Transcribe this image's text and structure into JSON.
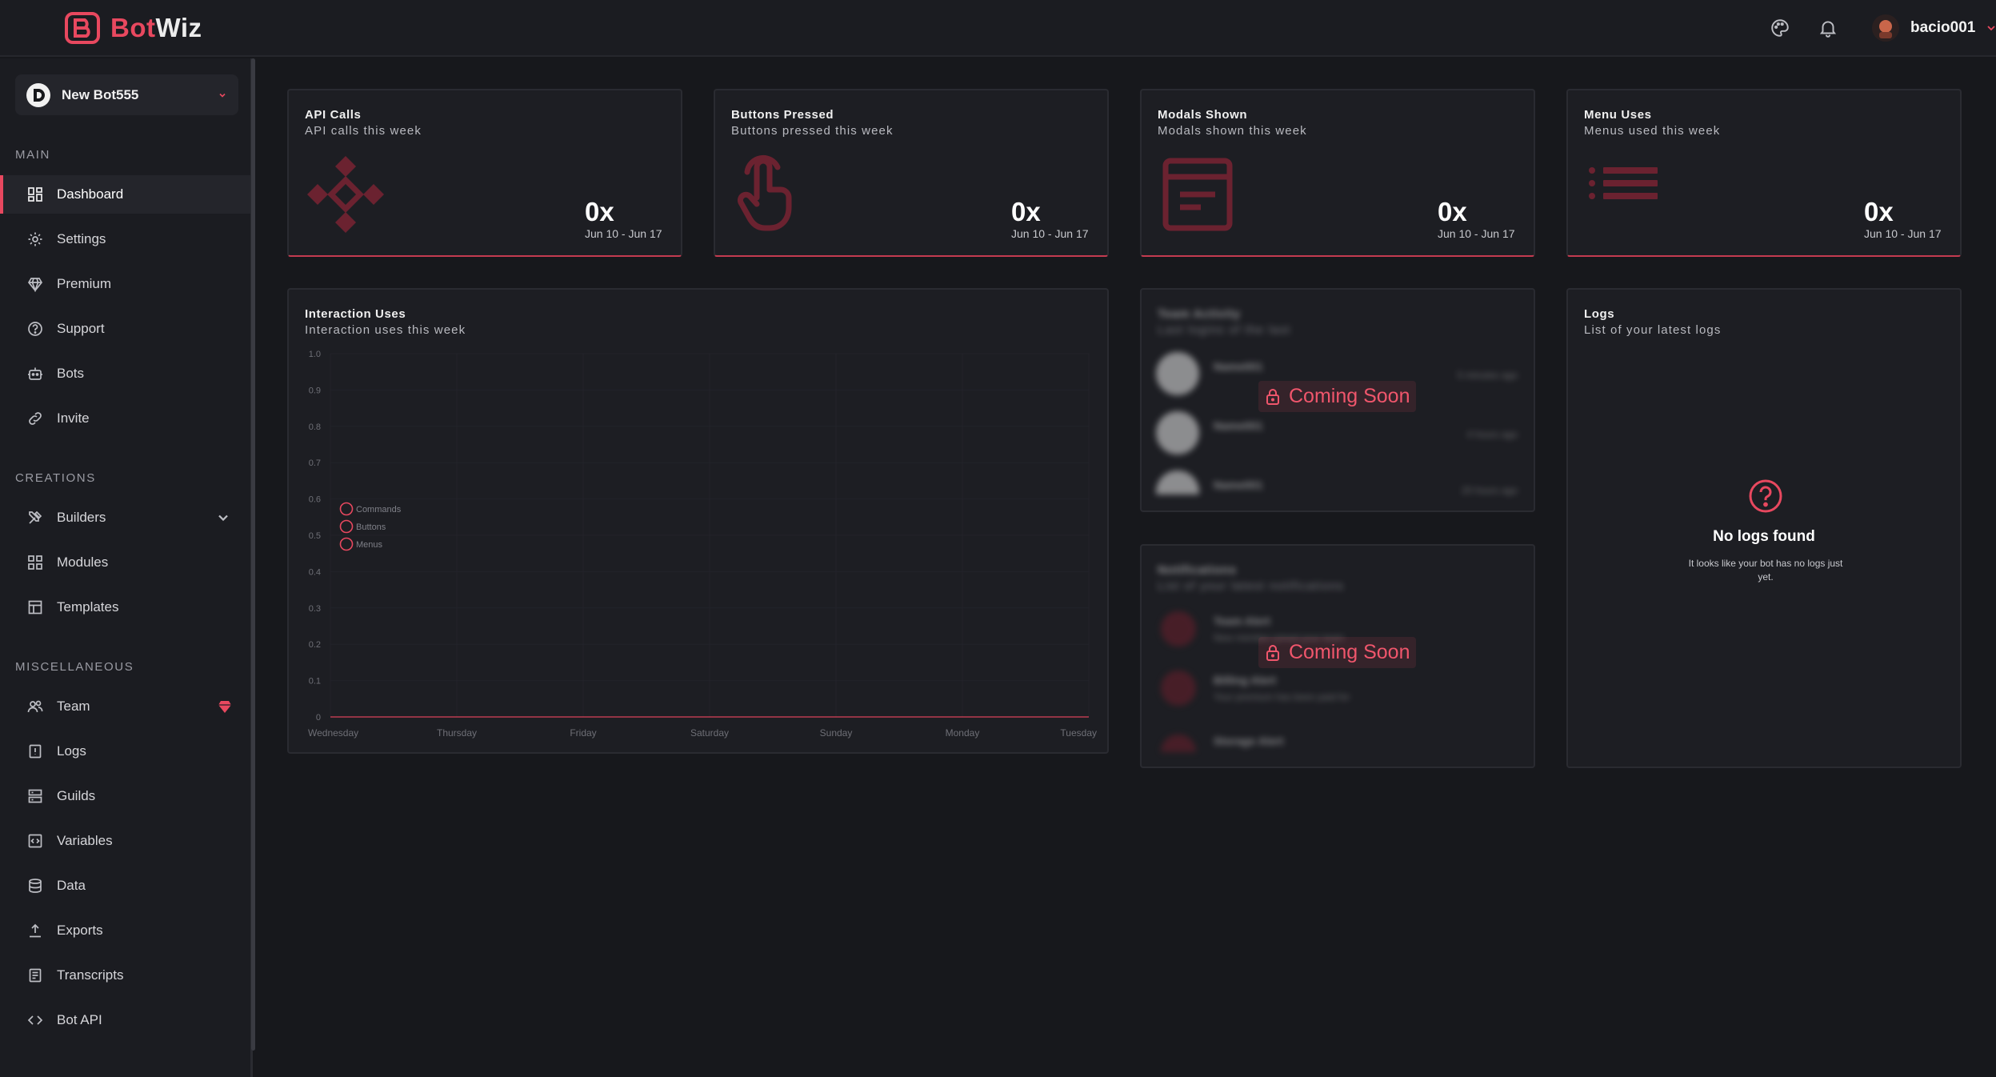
{
  "app": {
    "logo_bot": "Bot",
    "logo_wiz": "Wiz",
    "username": "bacio001",
    "accent": "#e8485f"
  },
  "sidebar": {
    "bot_name": "New Bot555",
    "sections": {
      "main": "MAIN",
      "creations": "CREATIONS",
      "misc": "MISCELLANEOUS"
    },
    "items": [
      {
        "label": "Dashboard",
        "icon": "dashboard-icon",
        "active": true
      },
      {
        "label": "Settings",
        "icon": "gear-icon"
      },
      {
        "label": "Premium",
        "icon": "diamond-icon"
      },
      {
        "label": "Support",
        "icon": "help-circle-icon"
      },
      {
        "label": "Bots",
        "icon": "robot-icon"
      },
      {
        "label": "Invite",
        "icon": "link-icon"
      },
      {
        "label": "Builders",
        "icon": "tools-icon"
      },
      {
        "label": "Modules",
        "icon": "modules-icon"
      },
      {
        "label": "Templates",
        "icon": "template-icon"
      },
      {
        "label": "Team",
        "icon": "users-icon"
      },
      {
        "label": "Logs",
        "icon": "clipboard-icon"
      },
      {
        "label": "Guilds",
        "icon": "server-icon"
      },
      {
        "label": "Variables",
        "icon": "code-box-icon"
      },
      {
        "label": "Data",
        "icon": "database-icon"
      },
      {
        "label": "Exports",
        "icon": "upload-icon"
      },
      {
        "label": "Transcripts",
        "icon": "file-text-icon"
      },
      {
        "label": "Bot API",
        "icon": "code-icon"
      }
    ]
  },
  "stats": [
    {
      "title": "API Calls",
      "subtitle": "API calls this week",
      "value": "0x",
      "range": "Jun 10 - Jun 17",
      "icon": "api-diamond-icon"
    },
    {
      "title": "Buttons Pressed",
      "subtitle": "Buttons pressed this week",
      "value": "0x",
      "range": "Jun 10 - Jun 17",
      "icon": "pointer-hand-icon"
    },
    {
      "title": "Modals Shown",
      "subtitle": "Modals shown this week",
      "value": "0x",
      "range": "Jun 10 - Jun 17",
      "icon": "modal-window-icon"
    },
    {
      "title": "Menu Uses",
      "subtitle": "Menus used this week",
      "value": "0x",
      "range": "Jun 10 - Jun 17",
      "icon": "list-icon"
    }
  ],
  "interaction": {
    "title": "Interaction Uses",
    "subtitle": "Interaction uses this week"
  },
  "chart_data": {
    "type": "line",
    "title": "Interaction Uses",
    "subtitle": "Interaction uses this week",
    "categories": [
      "Wednesday",
      "Thursday",
      "Friday",
      "Saturday",
      "Sunday",
      "Monday",
      "Tuesday"
    ],
    "yticks": [
      "1.0",
      "0.9",
      "0.8",
      "0.7",
      "0.6",
      "0.5",
      "0.4",
      "0.3",
      "0.2",
      "0.1",
      "0"
    ],
    "ylim": [
      0,
      1
    ],
    "grid": true,
    "legend_position": "left",
    "series": [
      {
        "name": "Commands",
        "values": [
          0,
          0,
          0,
          0,
          0,
          0,
          0
        ]
      },
      {
        "name": "Buttons",
        "values": [
          0,
          0,
          0,
          0,
          0,
          0,
          0
        ]
      },
      {
        "name": "Menus",
        "values": [
          0,
          0,
          0,
          0,
          0,
          0,
          0
        ]
      }
    ]
  },
  "coming_soon": "Coming Soon",
  "team_activity": {
    "title": "Team Activity",
    "subtitle": "Last logins of the last",
    "rows": [
      {
        "name": "Name001",
        "time": "5 minutes ago"
      },
      {
        "name": "Name001",
        "time": "4 hours ago"
      },
      {
        "name": "Name001",
        "time": "20 hours ago"
      }
    ]
  },
  "notifications": {
    "title": "Notifications",
    "subtitle": "List of your latest notifications",
    "rows": [
      {
        "name": "Team Alert",
        "text": "New member joined your team"
      },
      {
        "name": "Billing Alert",
        "text": "Your premium has been paid for"
      },
      {
        "name": "Storage Alert",
        "text": ""
      }
    ]
  },
  "logs": {
    "title": "Logs",
    "subtitle": "List of your latest logs",
    "empty_title": "No logs found",
    "empty_text": "It looks like your bot has no logs just yet."
  }
}
